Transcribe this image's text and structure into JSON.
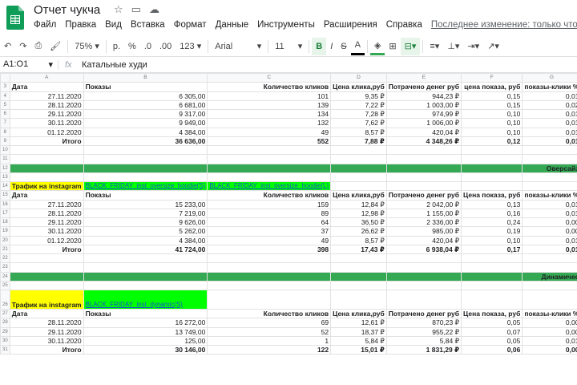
{
  "app": {
    "title": "Отчет чукча",
    "menu": [
      "Файл",
      "Правка",
      "Вид",
      "Вставка",
      "Формат",
      "Данные",
      "Инструменты",
      "Расширения",
      "Справка"
    ],
    "last_edit": "Последнее изменение: только что"
  },
  "toolbar": {
    "zoom": "75%",
    "currency": "р.",
    "percent": "%",
    "dec_less": ".0",
    "dec_more": ".00",
    "number_format": "123",
    "font": "Arial",
    "font_size": "11",
    "bold": "B",
    "strike": "S",
    "text_color": "A"
  },
  "formula": {
    "cell_ref": "A1:O1",
    "fx": "fx",
    "value": "Катальные худи"
  },
  "columns": [
    "A",
    "B",
    "C",
    "D",
    "E",
    "F",
    "G"
  ],
  "rows": [
    {
      "n": "3",
      "type": "hdr",
      "c": [
        "Дата",
        "Показы",
        "Количество кликов",
        "Цена клика,руб",
        "Потрачено денег руб",
        "цена показа, руб",
        "показы-клики %"
      ]
    },
    {
      "n": "4",
      "c": [
        "27.11.2020",
        "6 305,00",
        "101",
        "9,35 ₽",
        "944,23 ₽",
        "0,15",
        "0,01"
      ]
    },
    {
      "n": "5",
      "c": [
        "28.11.2020",
        "6 681,00",
        "139",
        "7,22 ₽",
        "1 003,00 ₽",
        "0,15",
        "0,02"
      ]
    },
    {
      "n": "6",
      "c": [
        "29.11.2020",
        "9 317,00",
        "134",
        "7,28 ₽",
        "974,99 ₽",
        "0,10",
        "0,01"
      ]
    },
    {
      "n": "7",
      "c": [
        "30.11.2020",
        "9 949,00",
        "132",
        "7,62 ₽",
        "1 006,00 ₽",
        "0,10",
        "0,01"
      ]
    },
    {
      "n": "8",
      "c": [
        "01.12.2020",
        "4 384,00",
        "49",
        "8,57 ₽",
        "420,04 ₽",
        "0,10",
        "0,01"
      ]
    },
    {
      "n": "9",
      "type": "total",
      "c": [
        "Итого",
        "36 636,00",
        "552",
        "7,88 ₽",
        "4 348,26 ₽",
        "0,12",
        "0,01"
      ]
    },
    {
      "n": "10",
      "type": "empty"
    },
    {
      "n": "11",
      "type": "empty"
    },
    {
      "n": "12",
      "type": "green",
      "label": "Оверсайз"
    },
    {
      "n": "13",
      "type": "empty"
    },
    {
      "n": "14",
      "type": "promo",
      "label": "Трафик на instagram",
      "links": [
        "BLACK_FRIDAY_inst_oversize_hoodie(S)",
        "BLACK_FRIDAY_inst_oversize_hoodie(L)"
      ]
    },
    {
      "n": "15",
      "type": "hdr",
      "c": [
        "Дата",
        "Показы",
        "Количество кликов",
        "Цена клика,руб",
        "Потрачено денег руб",
        "Цена показа, руб",
        "показы-клики %"
      ]
    },
    {
      "n": "16",
      "c": [
        "27.11.2020",
        "15 233,00",
        "159",
        "12,84 ₽",
        "2 042,00 ₽",
        "0,13",
        "0,01"
      ]
    },
    {
      "n": "17",
      "c": [
        "28.11.2020",
        "7 219,00",
        "89",
        "12,98 ₽",
        "1 155,00 ₽",
        "0,16",
        "0,01"
      ]
    },
    {
      "n": "18",
      "c": [
        "29.11.2020",
        "9 626,00",
        "64",
        "36,50 ₽",
        "2 336,00 ₽",
        "0,24",
        "0,00"
      ]
    },
    {
      "n": "19",
      "c": [
        "30.11.2020",
        "5 262,00",
        "37",
        "26,62 ₽",
        "985,00 ₽",
        "0,19",
        "0,00"
      ]
    },
    {
      "n": "20",
      "c": [
        "01.12.2020",
        "4 384,00",
        "49",
        "8,57 ₽",
        "420,04 ₽",
        "0,10",
        "0,01"
      ]
    },
    {
      "n": "21",
      "type": "total",
      "c": [
        "Итого",
        "41 724,00",
        "398",
        "17,43 ₽",
        "6 938,04 ₽",
        "0,17",
        "0,01"
      ]
    },
    {
      "n": "22",
      "type": "empty"
    },
    {
      "n": "23",
      "type": "empty"
    },
    {
      "n": "24",
      "type": "green",
      "label": "Динамичес"
    },
    {
      "n": "25",
      "type": "empty"
    },
    {
      "n": "26",
      "type": "promo2",
      "label": "Трафик на instagram",
      "links": [
        "BLACK_FRIDAY_inst_dynamic(S)"
      ]
    },
    {
      "n": "27",
      "type": "hdr",
      "c": [
        "Дата",
        "Показы",
        "Количество кликов",
        "Цена клика,руб",
        "Потрачено денег руб",
        "Цена показа, руб",
        "показы-клики %"
      ]
    },
    {
      "n": "28",
      "c": [
        "28.11.2020",
        "16 272,00",
        "69",
        "12,61 ₽",
        "870,23 ₽",
        "0,05",
        "0,00"
      ]
    },
    {
      "n": "29",
      "c": [
        "29.11.2020",
        "13 749,00",
        "52",
        "18,37 ₽",
        "955,22 ₽",
        "0,07",
        "0,00"
      ]
    },
    {
      "n": "30",
      "c": [
        "30.11.2020",
        "125,00",
        "1",
        "5,84 ₽",
        "5,84 ₽",
        "0,05",
        "0,01"
      ]
    },
    {
      "n": "31",
      "type": "total",
      "c": [
        "Итого",
        "30 146,00",
        "122",
        "15,01 ₽",
        "1 831,29 ₽",
        "0,06",
        "0,00"
      ]
    }
  ]
}
